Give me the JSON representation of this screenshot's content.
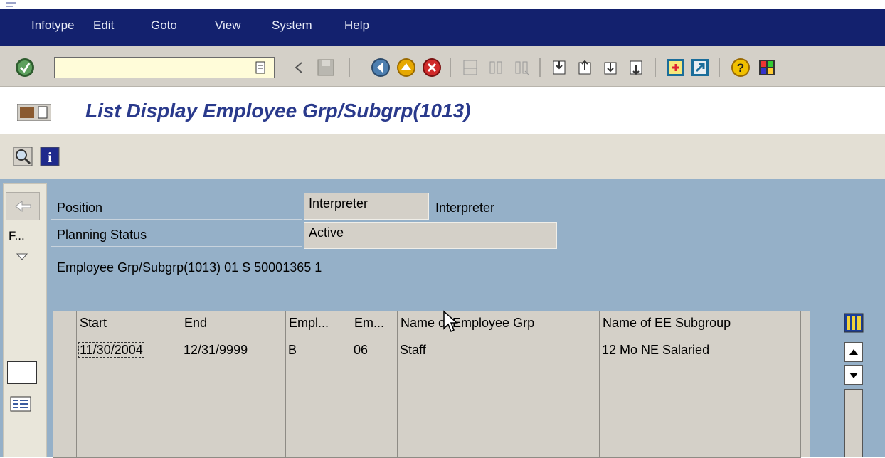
{
  "menu": {
    "items": [
      "Infotype",
      "Edit",
      "Goto",
      "View",
      "System",
      "Help"
    ]
  },
  "toolbar": {
    "command_field_value": "",
    "icons": [
      "enter-icon",
      "command-history-icon",
      "back-arrow-icon",
      "save-icon",
      "back-icon",
      "exit-icon",
      "cancel-icon",
      "print-icon",
      "find-icon",
      "find-next-icon",
      "first-page-icon",
      "previous-page-icon",
      "next-page-icon",
      "last-page-icon",
      "create-session-icon",
      "shortcut-icon",
      "help-icon",
      "customize-layout-icon"
    ]
  },
  "header": {
    "title": "List Display Employee Grp/Subgrp(1013)"
  },
  "form": {
    "position_label": "Position",
    "position_value": "Interpreter",
    "position_text": "Interpreter",
    "planning_status_label": "Planning Status",
    "planning_status_value": "Active",
    "record_line": "Employee Grp/Subgrp(1013) 01 S  50001365 1"
  },
  "leftpane": {
    "item_label": "F..."
  },
  "table": {
    "columns": [
      "Start",
      "End",
      "Empl...",
      "Em...",
      "Name of Employee Grp",
      "Name of EE Subgroup"
    ],
    "rows": [
      [
        "11/30/2004",
        "12/31/9999",
        "B",
        "06",
        "Staff",
        "12 Mo NE Salaried"
      ]
    ]
  },
  "colors": {
    "menubar": "#13216e",
    "main_bg": "#95b0c8",
    "title": "#2a3a8c",
    "command_field": "#fffcd9"
  }
}
